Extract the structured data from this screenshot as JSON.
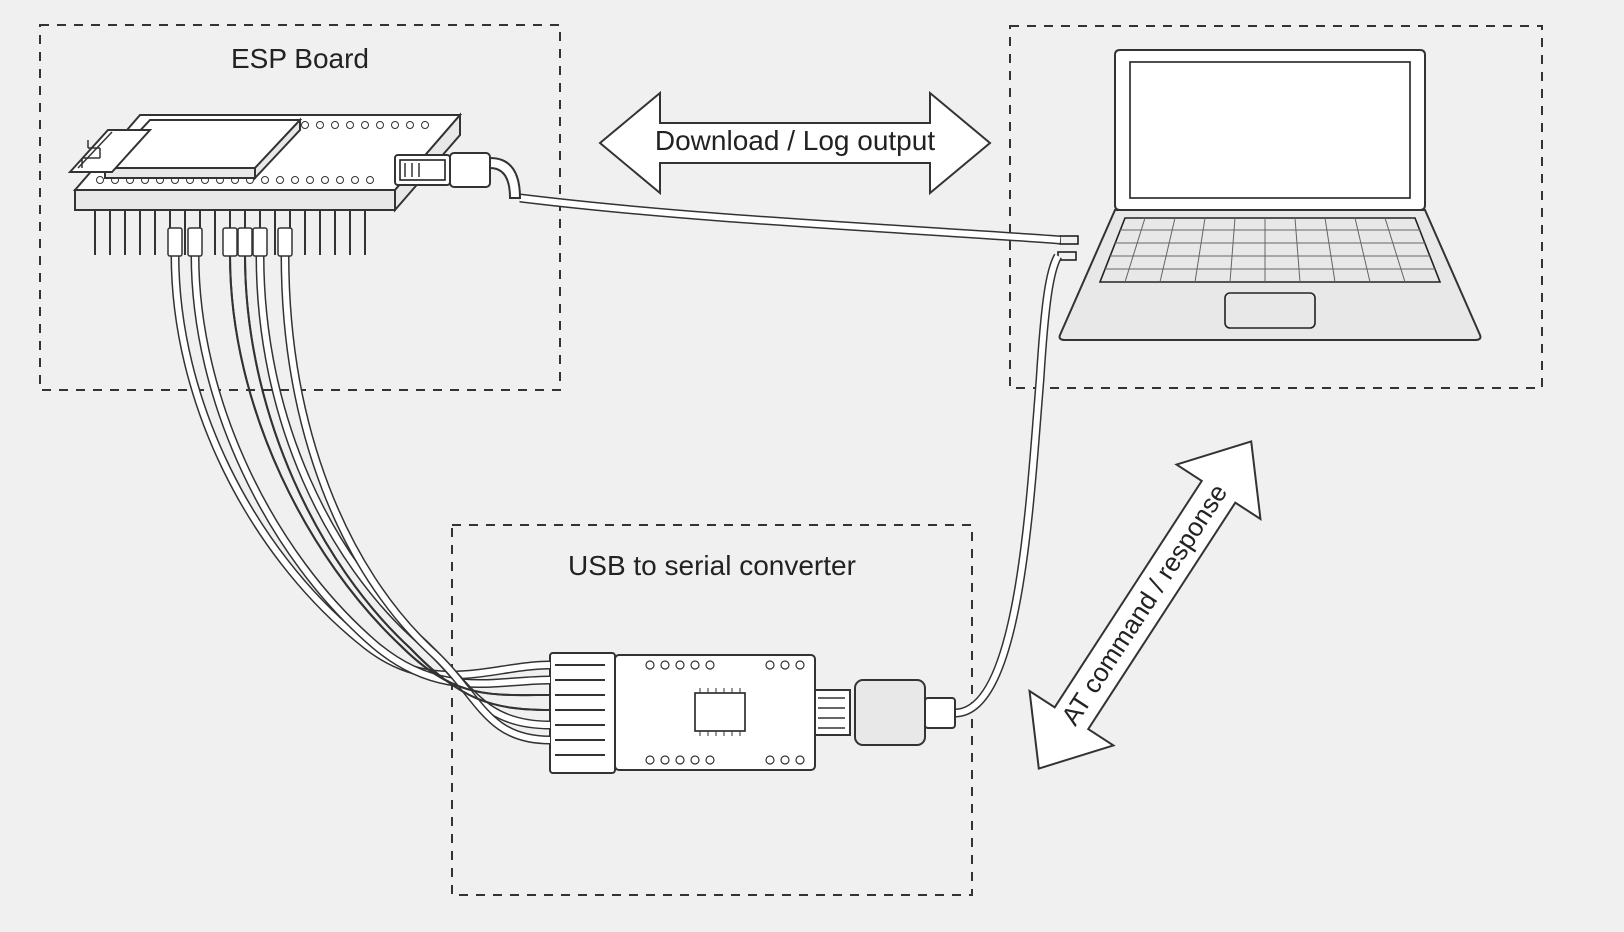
{
  "labels": {
    "esp": "ESP Board",
    "usb_conv": "USB to serial converter",
    "top_arrow": "Download / Log output",
    "right_arrow": "AT command / response"
  }
}
